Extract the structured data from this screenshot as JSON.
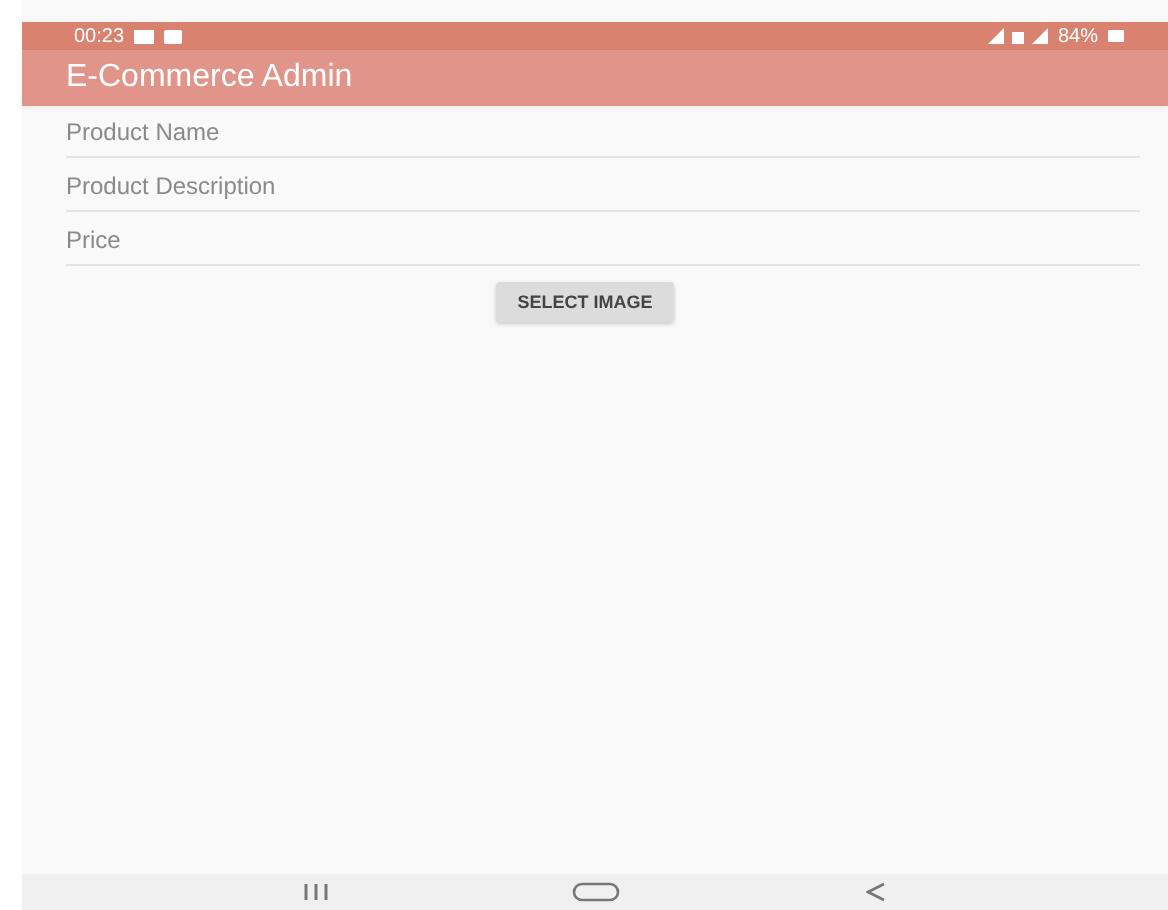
{
  "status_bar": {
    "time": "00:23",
    "battery": "84%"
  },
  "app_bar": {
    "title": "E-Commerce Admin"
  },
  "fields": [
    {
      "placeholder": "Product Name"
    },
    {
      "placeholder": "Product Description"
    },
    {
      "placeholder": "Price"
    }
  ],
  "buttons": [
    "SELECT IMAGE"
  ]
}
